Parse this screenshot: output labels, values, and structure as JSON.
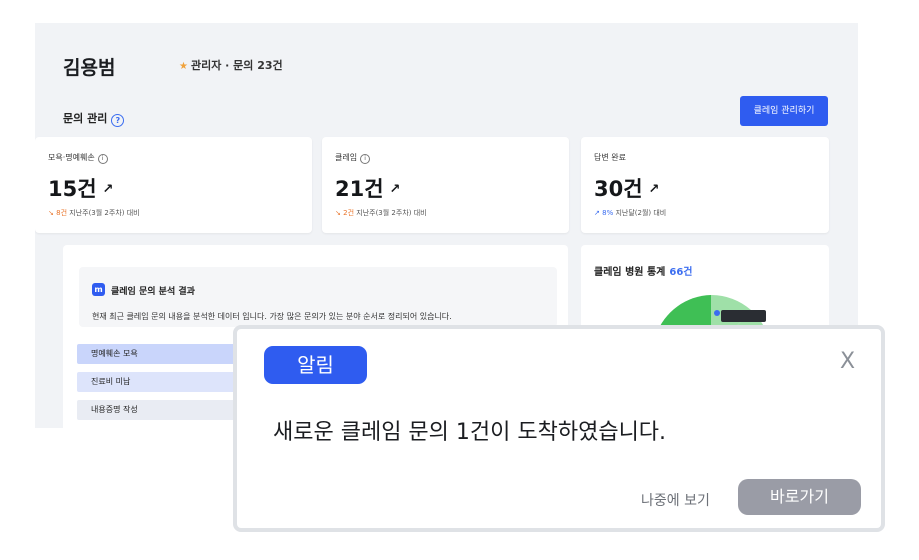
{
  "header": {
    "user_name": "김용범",
    "user_meta": "관리자 · 문의 23건"
  },
  "section": {
    "title": "문의 관리",
    "manage_button": "클레임 관리하기"
  },
  "cards": [
    {
      "label": "모욕·명예훼손",
      "value": "15건",
      "delta_value": "8건",
      "delta_text": "지난주(3월 2주차) 대비",
      "trend": "down"
    },
    {
      "label": "클레임",
      "value": "21건",
      "delta_value": "2건",
      "delta_text": "지난주(3월 2주차) 대비",
      "trend": "down"
    },
    {
      "label": "답변 완료",
      "value": "30건",
      "delta_value": "8%",
      "delta_text": "지난달(2월) 대비",
      "trend": "up"
    }
  ],
  "analysis": {
    "badge": "m",
    "title": "클레임 문의 분석 결과",
    "description": "현재 최근 클레임 문의 내용을 분석한 데이터 입니다. 가장 많은 문의가 있는 분야 순서로 정리되어 있습니다.",
    "rows": [
      "명예훼손 모욕",
      "진료비 미납",
      "내용증명 작성"
    ]
  },
  "stats": {
    "title": "클레임 병원 통계",
    "count": "66건"
  },
  "modal": {
    "badge": "알림",
    "close": "X",
    "message": "새로운 클레임 문의 1건이 도착하였습니다.",
    "later": "나중에 보기",
    "go": "바로가기"
  },
  "colors": {
    "accent": "#2f5cf0",
    "down": "#e9742a",
    "up": "#3b6df0",
    "pie_green": "#3fbf55",
    "pie_light_green": "#9fe0a8"
  }
}
